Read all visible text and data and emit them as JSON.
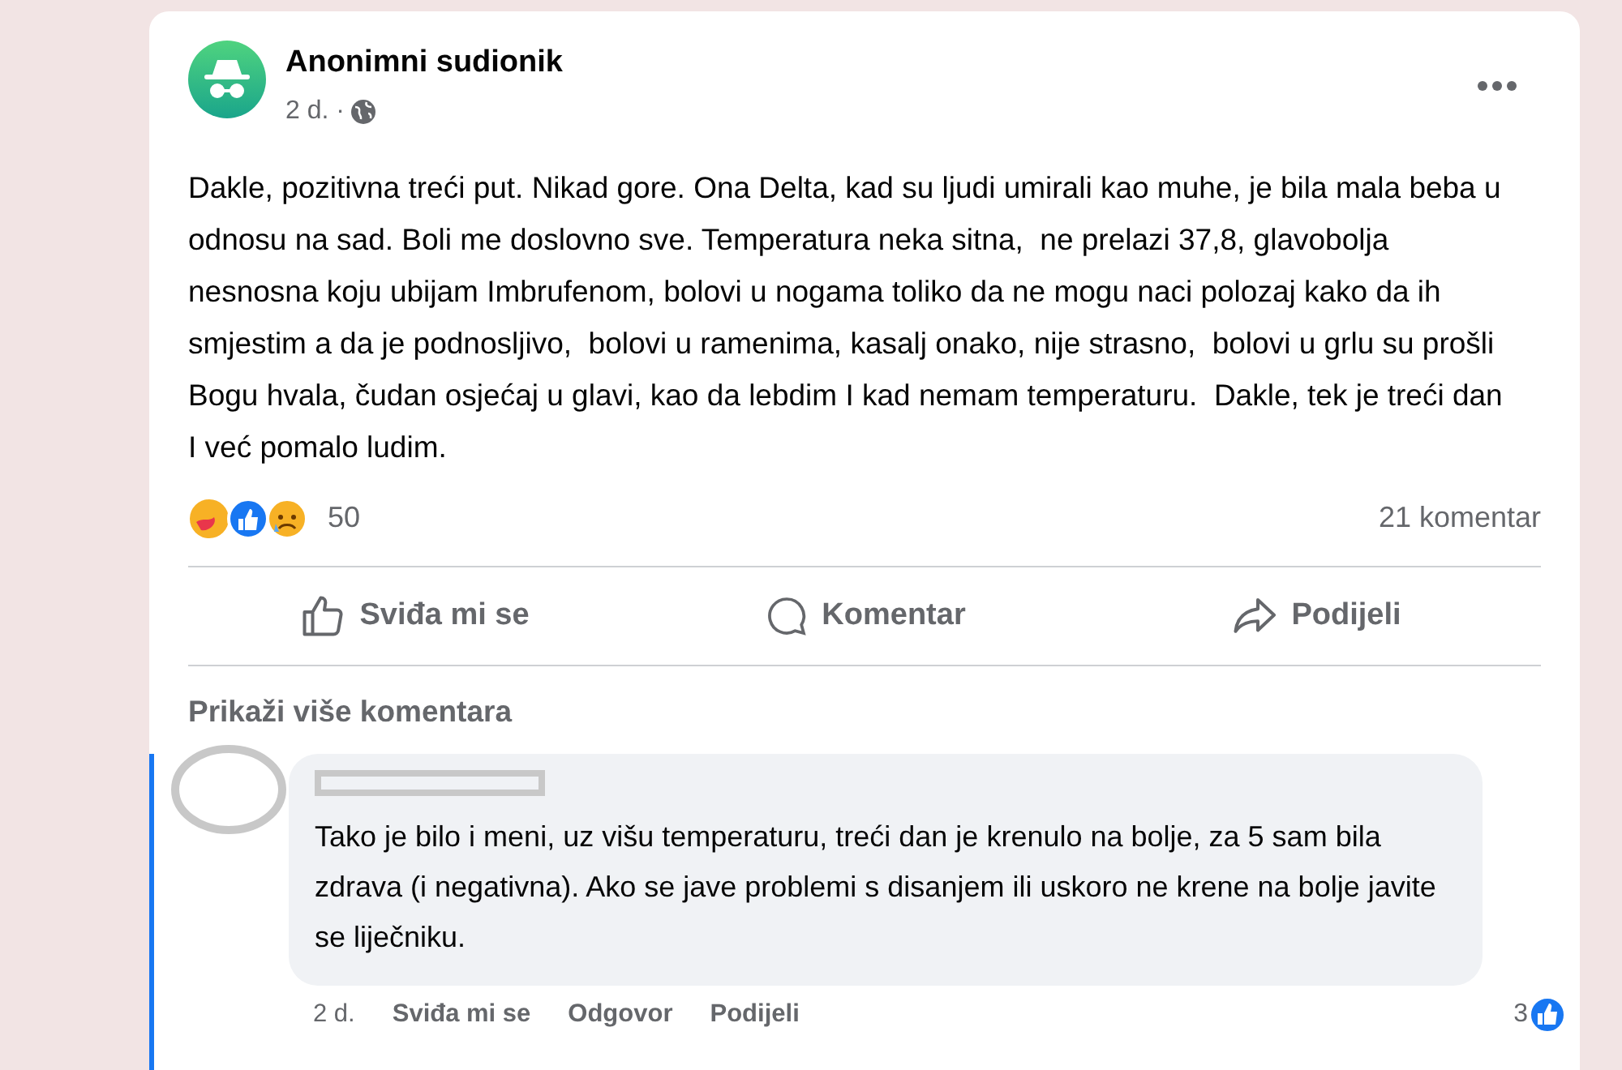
{
  "post": {
    "author": "Anonimni sudionik",
    "time": "2 d. ·",
    "text": "Dakle, pozitivna treći put. Nikad gore. Ona Delta, kad su ljudi umirali kao muhe, je bila mala beba u odnosu na sad. Boli me doslovno sve. Temperatura neka sitna,  ne prelazi 37,8, glavobolja nesnosna koju ubijam Imbrufenom, bolovi u nogama toliko da ne mogu naci polozaj kako da ih smjestim a da je podnosljivo,  bolovi u ramenima, kasalj onako, nije strasno,  bolovi u grlu su prošli Bogu hvala, čudan osjećaj u glavi, kao da lebdim I kad nemam temperaturu.  Dakle, tek je treći dan I već pomalo ludim.",
    "reaction_count": "50",
    "comment_count": "21 komentar"
  },
  "actions": [
    {
      "kind": "like",
      "label": "Sviđa mi se"
    },
    {
      "kind": "comment",
      "label": "Komentar"
    },
    {
      "kind": "share",
      "label": "Podijeli"
    }
  ],
  "more_comments": "Prikaži više komentara",
  "comment": {
    "text": "Tako je bilo i meni, uz višu temperaturu, treći dan je krenulo na bolje, za 5 sam bila zdrava (i negativna). Ako se jave problemi s disanjem ili uskoro ne krene na bolje javite se liječniku.",
    "time": "2 d.",
    "actions": [
      "Sviđa mi se",
      "Odgovor",
      "Podijeli"
    ],
    "like_count": "3"
  }
}
